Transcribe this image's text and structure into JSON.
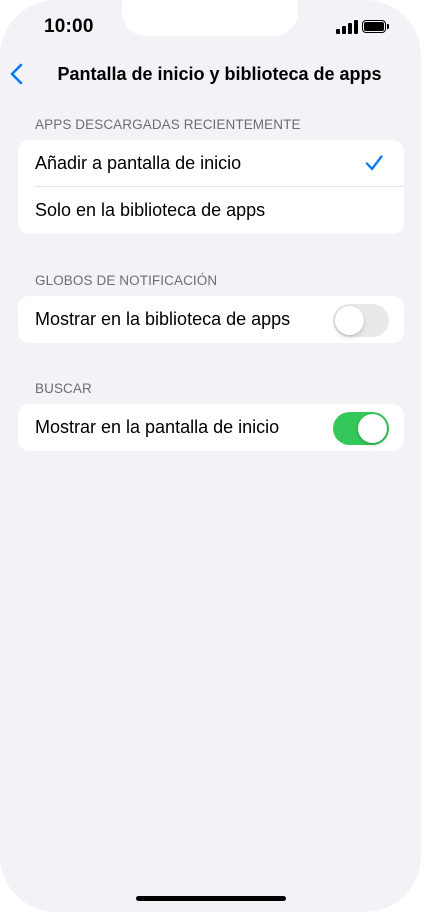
{
  "status_bar": {
    "time": "10:00",
    "icons": [
      "signal-icon",
      "battery-icon"
    ]
  },
  "nav": {
    "back_icon": "chevron-left-icon",
    "title": "Pantalla de inicio y biblioteca de apps"
  },
  "sections": [
    {
      "header": "APPS DESCARGADAS RECIENTEMENTE",
      "rows": [
        {
          "label": "Añadir a pantalla de inicio",
          "selected": true
        },
        {
          "label": "Solo en la biblioteca de apps",
          "selected": false
        }
      ]
    },
    {
      "header": "GLOBOS DE NOTIFICACIÓN",
      "rows": [
        {
          "label": "Mostrar en la biblioteca de apps",
          "toggle": false
        }
      ]
    },
    {
      "header": "BUSCAR",
      "rows": [
        {
          "label": "Mostrar en la pantalla de inicio",
          "toggle": true
        }
      ]
    }
  ],
  "colors": {
    "accent": "#007aff",
    "toggle_on": "#34c759",
    "toggle_off": "#e9e9eb",
    "background": "#f2f2f7",
    "section_header": "#6d6d72"
  }
}
